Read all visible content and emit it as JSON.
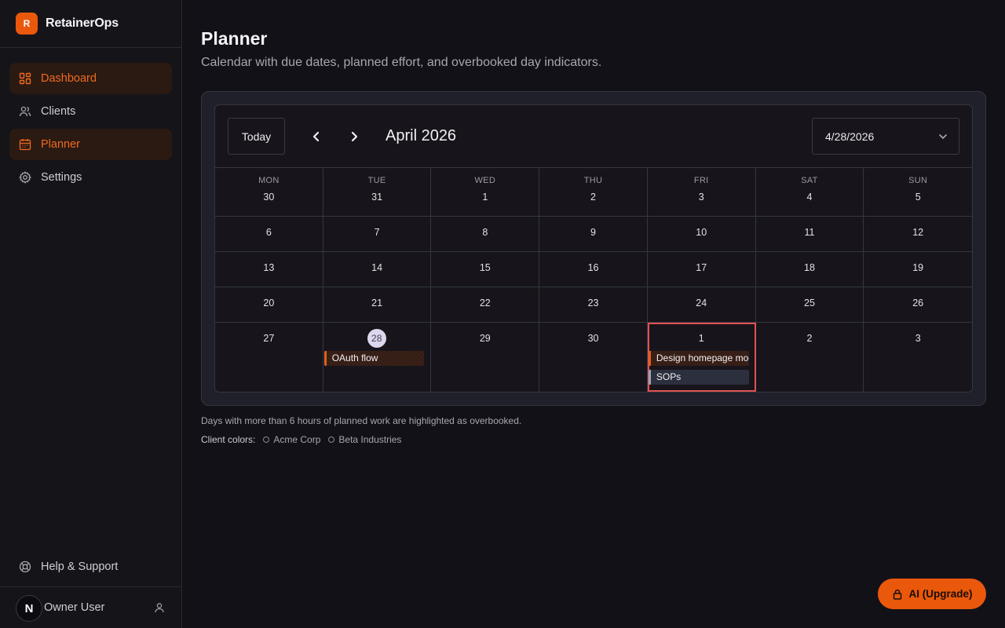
{
  "app": {
    "name": "RetainerOps",
    "logo_letter": "R"
  },
  "sidebar": {
    "items": [
      {
        "label": "Dashboard",
        "icon": "dashboard-icon",
        "active": true
      },
      {
        "label": "Clients",
        "icon": "users-icon",
        "active": false
      },
      {
        "label": "Planner",
        "icon": "calendar-icon",
        "active": true
      },
      {
        "label": "Settings",
        "icon": "gear-icon",
        "active": false
      }
    ],
    "help": "Help & Support",
    "user": {
      "name": "Owner User",
      "avatar_letter": "N"
    }
  },
  "page": {
    "title": "Planner",
    "subtitle": "Calendar with due dates, planned effort, and overbooked day indicators."
  },
  "calendar": {
    "today_label": "Today",
    "month_label": "April 2026",
    "selected_date": "4/28/2026",
    "weekdays": [
      "MON",
      "TUE",
      "WED",
      "THU",
      "FRI",
      "SAT",
      "SUN"
    ],
    "weeks": [
      [
        "30",
        "31",
        "1",
        "2",
        "3",
        "4",
        "5"
      ],
      [
        "6",
        "7",
        "8",
        "9",
        "10",
        "11",
        "12"
      ],
      [
        "13",
        "14",
        "15",
        "16",
        "17",
        "18",
        "19"
      ],
      [
        "20",
        "21",
        "22",
        "23",
        "24",
        "25",
        "26"
      ],
      [
        "27",
        "28",
        "29",
        "30",
        "1",
        "2",
        "3"
      ]
    ],
    "today": "28",
    "overbooked_day": "1",
    "events": [
      {
        "day": "28",
        "title": "OAuth flow",
        "client": "Acme Corp"
      },
      {
        "day": "1",
        "title": "Design homepage mockups",
        "client": "Acme Corp"
      },
      {
        "day": "1",
        "title": "SOPs",
        "client": "Beta Industries"
      }
    ]
  },
  "notes": {
    "overbooked": "Days with more than 6 hours of planned work are highlighted as overbooked.",
    "legend_label": "Client colors:",
    "clients": [
      "Acme Corp",
      "Beta Industries"
    ]
  },
  "colors": {
    "accent": "#ea580c",
    "overbooked": "#e05252",
    "acme": "#e2601a",
    "beta": "#9ea3b6"
  },
  "ai_button": "AI (Upgrade)"
}
